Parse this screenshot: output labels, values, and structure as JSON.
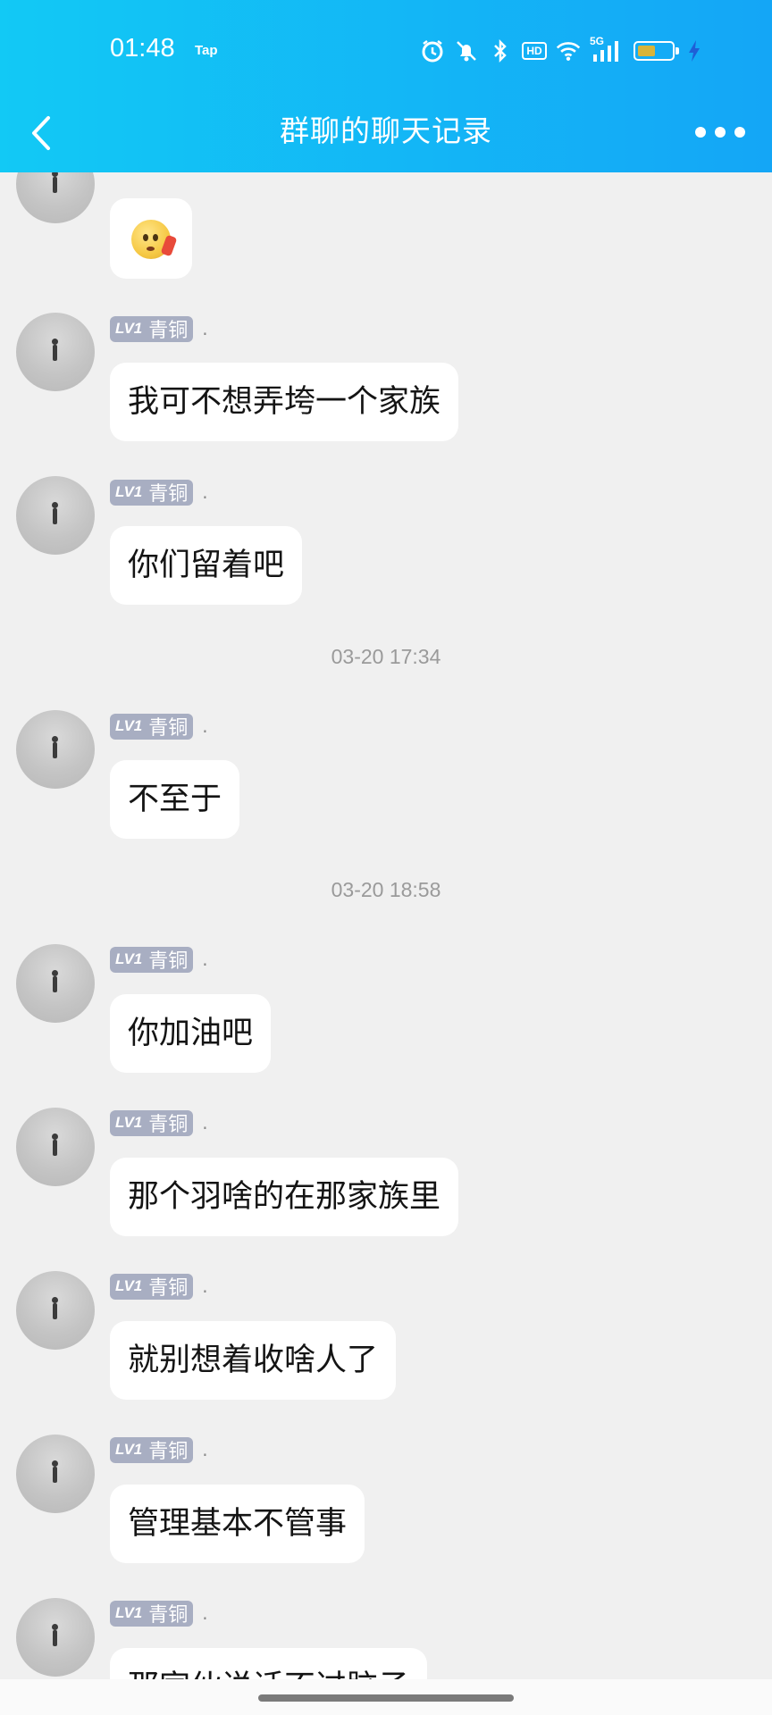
{
  "status_bar": {
    "time": "01:48",
    "app_indicator": "Tap",
    "network": "5G",
    "hd_label": "HD",
    "battery_level": 0.55,
    "icons": [
      "alarm-icon",
      "mute-icon",
      "bluetooth-icon",
      "hd-icon",
      "wifi-icon",
      "signal-icon",
      "battery-icon",
      "charging-icon"
    ]
  },
  "header": {
    "title": "群聊的聊天记录",
    "back_icon": "back-chevron-icon",
    "more_icon": "more-dots-icon",
    "background": [
      "#12c9f5",
      "#14a6f6"
    ]
  },
  "badge": {
    "level": "LV1",
    "title": "青铜",
    "color": "#a8aec2"
  },
  "messages": [
    {
      "nickname": ".",
      "text": ""
    },
    {
      "nickname": ".",
      "text": "我可不想弄垮一个家族"
    },
    {
      "nickname": ".",
      "text": "你们留着吧"
    },
    {
      "timestamp": "03-20 17:34"
    },
    {
      "nickname": ".",
      "text": "不至于"
    },
    {
      "timestamp": "03-20 18:58"
    },
    {
      "nickname": ".",
      "text": "你加油吧"
    },
    {
      "nickname": ".",
      "text": "那个羽啥的在那家族里"
    },
    {
      "nickname": ".",
      "text": "就别想着收啥人了"
    },
    {
      "nickname": ".",
      "text": "管理基本不管事"
    },
    {
      "nickname": ".",
      "text": "那家伙说话不过脑子"
    }
  ]
}
